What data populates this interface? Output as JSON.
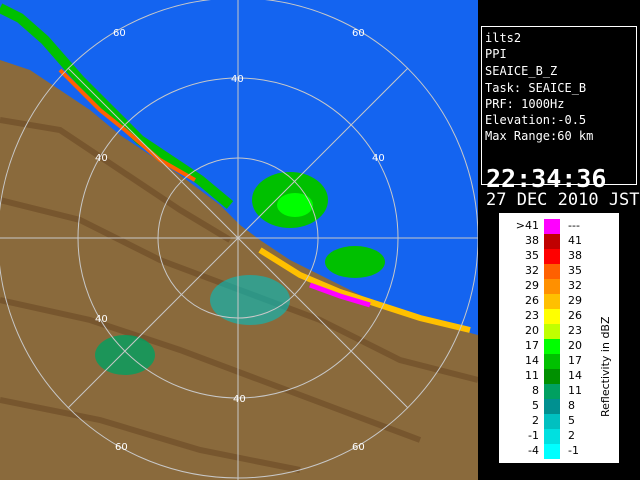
{
  "info": {
    "site": "ilts2",
    "mode": "PPI",
    "product": "SEAICE_B_Z",
    "task": "Task: SEAICE_B",
    "prf": "PRF: 1000Hz",
    "elevation": "Elevation:-0.5",
    "max_range": "Max Range:60 km",
    "time": "22:34:36",
    "date": "27 DEC 2010 JST"
  },
  "range_rings": [
    "60",
    "40",
    "40",
    "60",
    "40",
    "40",
    "40",
    "60",
    "60"
  ],
  "legend": {
    "title": "Reflectivity in dBZ",
    "rows": [
      {
        "left": ">41",
        "right": "---",
        "color": "#ff00ff"
      },
      {
        "left": "38",
        "right": "41",
        "color": "#c00000"
      },
      {
        "left": "35",
        "right": "38",
        "color": "#ff0000"
      },
      {
        "left": "32",
        "right": "35",
        "color": "#ff6000"
      },
      {
        "left": "29",
        "right": "32",
        "color": "#ff9000"
      },
      {
        "left": "26",
        "right": "29",
        "color": "#ffc000"
      },
      {
        "left": "23",
        "right": "26",
        "color": "#ffff00"
      },
      {
        "left": "20",
        "right": "23",
        "color": "#c0ff00"
      },
      {
        "left": "17",
        "right": "20",
        "color": "#00ff00"
      },
      {
        "left": "14",
        "right": "17",
        "color": "#00c000"
      },
      {
        "left": "11",
        "right": "14",
        "color": "#009000"
      },
      {
        "left": "8",
        "right": "11",
        "color": "#00a060"
      },
      {
        "left": "5",
        "right": "8",
        "color": "#009090"
      },
      {
        "left": "2",
        "right": "5",
        "color": "#00c0c0"
      },
      {
        "left": "-1",
        "right": "2",
        "color": "#00e0e0"
      },
      {
        "left": "-4",
        "right": "-1",
        "color": "#00ffff"
      }
    ]
  }
}
